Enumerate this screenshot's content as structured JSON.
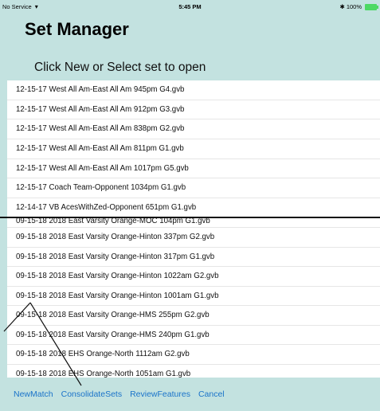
{
  "status_bar": {
    "carrier": "No Service",
    "wifi_icon": "wifi-icon",
    "time": "5:45 PM",
    "bluetooth_icon": "bluetooth-icon",
    "battery": "100%",
    "battery_icon": "battery-icon",
    "battery_color": "#4cd964"
  },
  "header": {
    "title": "Set Manager",
    "instruction": "Click New or Select set to open"
  },
  "recent_sets": [
    {
      "label": "12-15-17 West All Am-East All Am 945pm G4.gvb"
    },
    {
      "label": "12-15-17 West All Am-East All Am 912pm G3.gvb"
    },
    {
      "label": "12-15-17 West All Am-East All Am 838pm G2.gvb"
    },
    {
      "label": "12-15-17 West All Am-East All Am 811pm G1.gvb"
    },
    {
      "label": "12-15-17 West All Am-East All Am 1017pm G5.gvb"
    },
    {
      "label": "12-15-17 Coach Team-Opponent 1034pm G1.gvb"
    },
    {
      "label": "12-14-17 VB AcesWithZed-Opponent 651pm G1.gvb"
    }
  ],
  "other_sets": [
    {
      "label": "09-15-18 2018 East Varsity Orange-MOC 104pm G1.gvb"
    },
    {
      "label": "09-15-18 2018 East Varsity Orange-Hinton 337pm G2.gvb"
    },
    {
      "label": "09-15-18 2018 East Varsity Orange-Hinton 317pm G1.gvb"
    },
    {
      "label": "09-15-18 2018 East Varsity Orange-Hinton 1022am G2.gvb"
    },
    {
      "label": "09-15-18 2018 East Varsity Orange-Hinton 1001am G1.gvb"
    },
    {
      "label": "09-15-18 2018 East Varsity Orange-HMS 255pm G2.gvb"
    },
    {
      "label": "09-15-18 2018 East Varsity Orange-HMS 240pm G1.gvb"
    },
    {
      "label": "09-15-18 2018 EHS Orange-North 1112am G2.gvb"
    },
    {
      "label": "09-15-18 2018 EHS Orange-North 1051am G1.gvb"
    }
  ],
  "toolbar": {
    "new_match": "NewMatch",
    "consolidate_sets": "ConsolidateSets",
    "review_features": "ReviewFeatures",
    "cancel": "Cancel"
  },
  "colors": {
    "background": "#c3e2e0",
    "link": "#1a73c9"
  }
}
